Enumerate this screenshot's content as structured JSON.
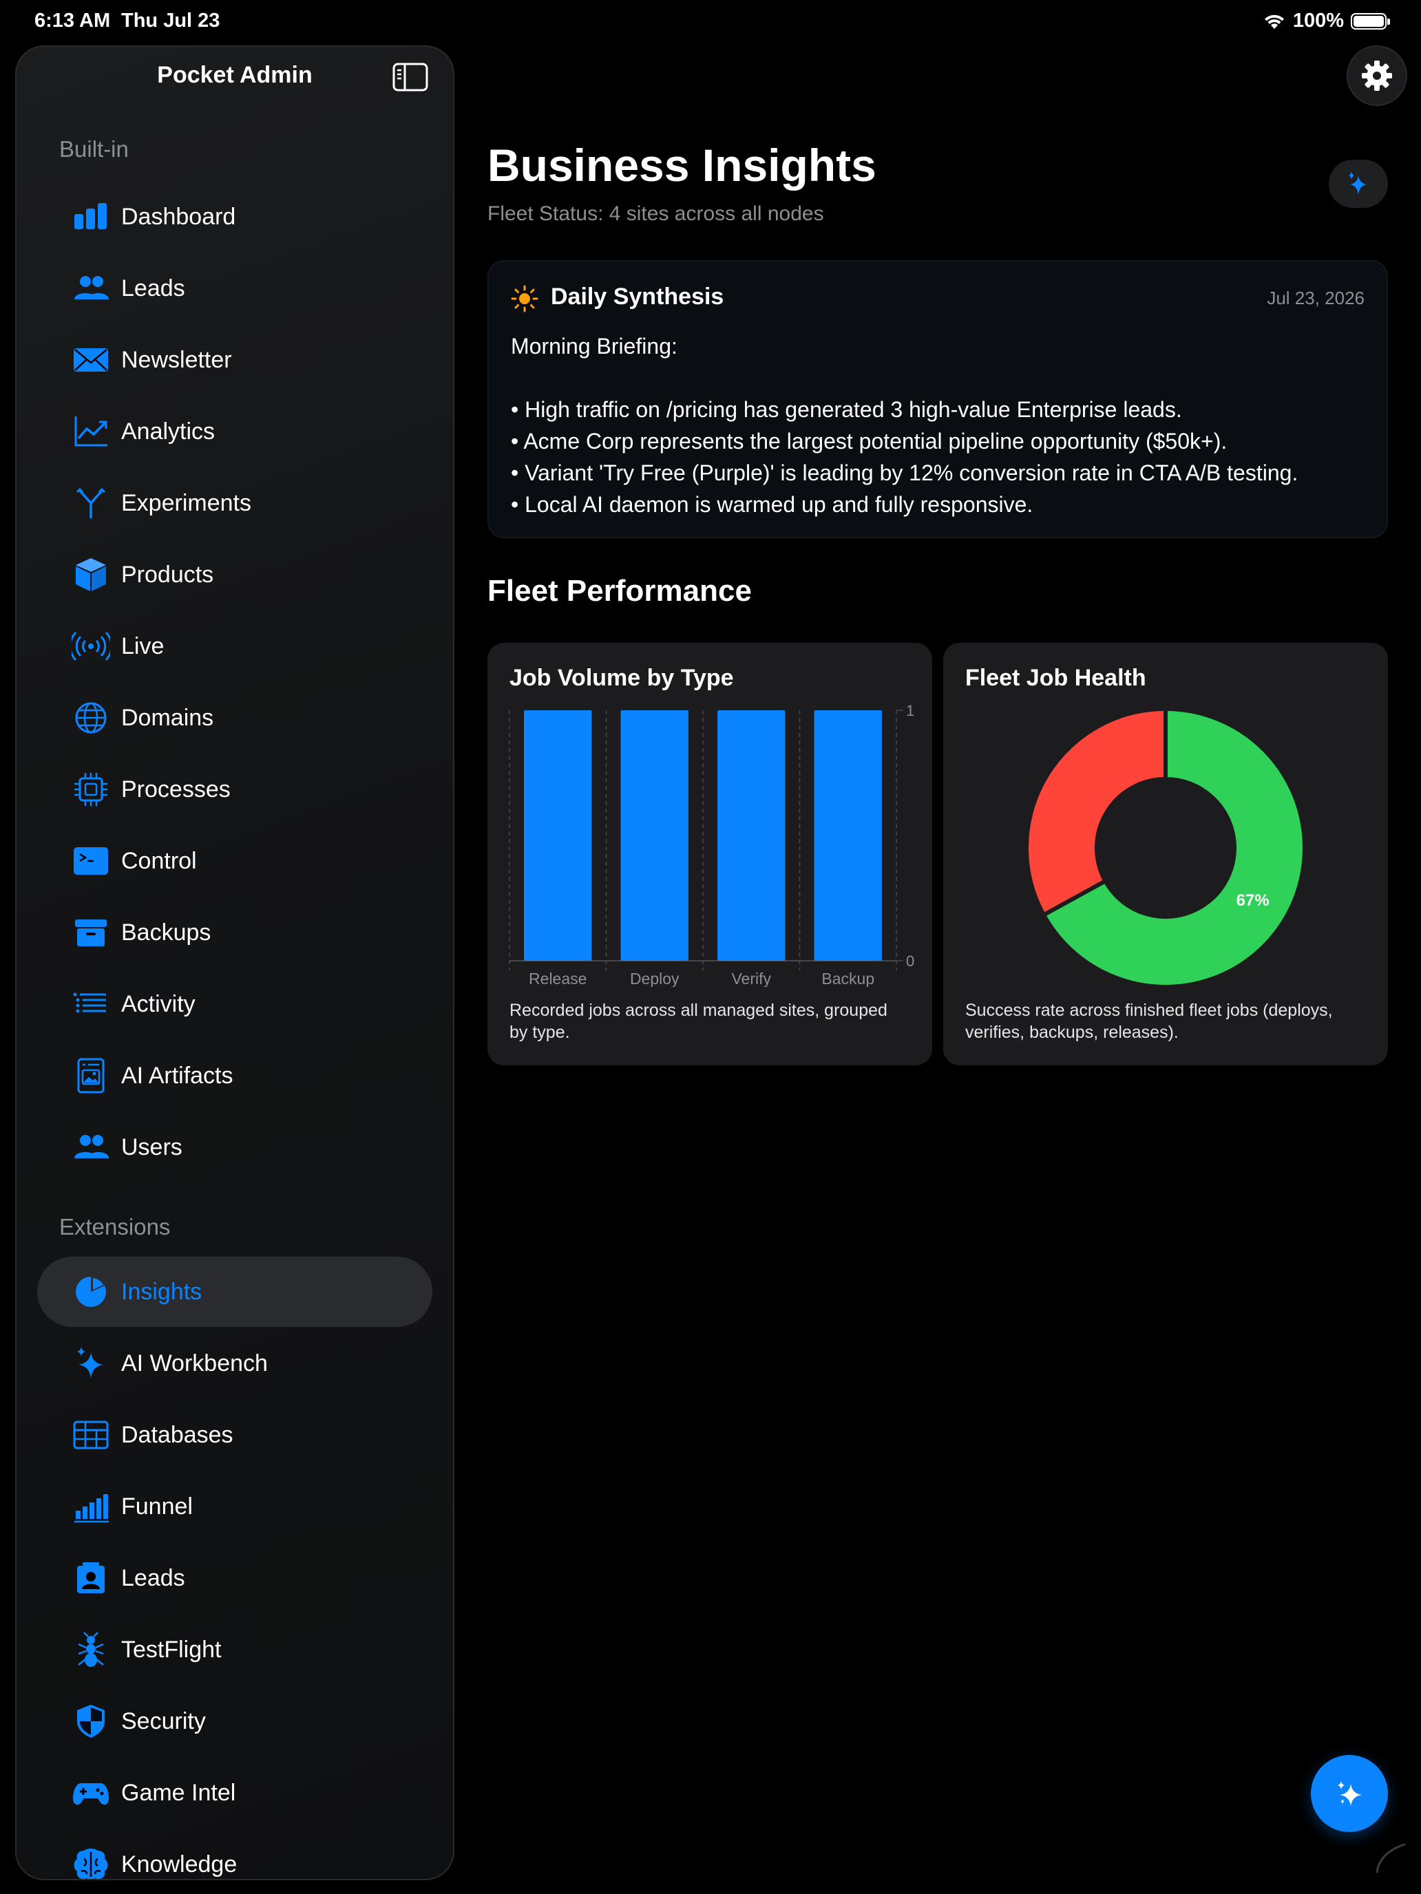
{
  "status_bar": {
    "time": "6:13 AM",
    "date": "Thu Jul 23",
    "battery": "100%"
  },
  "sidebar": {
    "title": "Pocket Admin",
    "sections": [
      {
        "label": "Built-in",
        "items": [
          {
            "label": "Dashboard",
            "icon": "bar-chart-icon"
          },
          {
            "label": "Leads",
            "icon": "people-icon"
          },
          {
            "label": "Newsletter",
            "icon": "envelope-icon"
          },
          {
            "label": "Analytics",
            "icon": "trend-chart-icon"
          },
          {
            "label": "Experiments",
            "icon": "branch-icon"
          },
          {
            "label": "Products",
            "icon": "box-icon"
          },
          {
            "label": "Live",
            "icon": "broadcast-icon"
          },
          {
            "label": "Domains",
            "icon": "globe-icon"
          },
          {
            "label": "Processes",
            "icon": "cpu-icon"
          },
          {
            "label": "Control",
            "icon": "terminal-icon"
          },
          {
            "label": "Backups",
            "icon": "archive-box-icon"
          },
          {
            "label": "Activity",
            "icon": "list-icon"
          },
          {
            "label": "AI Artifacts",
            "icon": "document-image-icon"
          },
          {
            "label": "Users",
            "icon": "people-icon"
          }
        ]
      },
      {
        "label": "Extensions",
        "items": [
          {
            "label": "Insights",
            "icon": "pie-chart-icon",
            "active": true
          },
          {
            "label": "AI Workbench",
            "icon": "sparkles-icon"
          },
          {
            "label": "Databases",
            "icon": "table-icon"
          },
          {
            "label": "Funnel",
            "icon": "bars-ascending-icon"
          },
          {
            "label": "Leads",
            "icon": "contact-card-icon"
          },
          {
            "label": "TestFlight",
            "icon": "ant-icon"
          },
          {
            "label": "Security",
            "icon": "shield-icon"
          },
          {
            "label": "Game Intel",
            "icon": "gamepad-icon"
          },
          {
            "label": "Knowledge",
            "icon": "brain-icon"
          }
        ]
      }
    ]
  },
  "main": {
    "title": "Business Insights",
    "subtitle": "Fleet Status: 4 sites across all nodes",
    "synthesis": {
      "title": "Daily Synthesis",
      "date": "Jul 23, 2026",
      "lines": [
        "Morning Briefing:",
        "",
        "• High traffic on /pricing has generated 3 high-value Enterprise leads.",
        "• Acme Corp represents the largest potential pipeline opportunity ($50k+).",
        "• Variant 'Try Free (Purple)' is leading by 12% conversion rate in CTA A/B testing.",
        "• Local AI daemon is warmed up and fully responsive."
      ]
    },
    "section_title": "Fleet Performance",
    "cards": {
      "job_volume": {
        "title": "Job Volume by Type",
        "description": "Recorded jobs across all managed sites, grouped by type."
      },
      "fleet_health": {
        "title": "Fleet Job Health",
        "description": "Success rate across finished fleet jobs (deploys, verifies, backups, releases)."
      }
    }
  },
  "colors": {
    "accent": "#0a84ff",
    "success": "#30d158",
    "failure": "#ff453a",
    "sun": "#ff9f0a"
  },
  "chart_data": [
    {
      "type": "bar",
      "categories": [
        "Release",
        "Deploy",
        "Verify",
        "Backup"
      ],
      "values": [
        1,
        1,
        1,
        1
      ],
      "title": "Job Volume by Type",
      "ylim": [
        0,
        1
      ],
      "yticks": [
        "0",
        "1"
      ],
      "grid": true,
      "color": "#0a84ff"
    },
    {
      "type": "pie",
      "title": "Fleet Job Health",
      "donut": true,
      "slices": [
        {
          "value": 67,
          "color": "#30d158",
          "label": "67%"
        },
        {
          "value": 33,
          "color": "#ff453a"
        }
      ]
    }
  ]
}
